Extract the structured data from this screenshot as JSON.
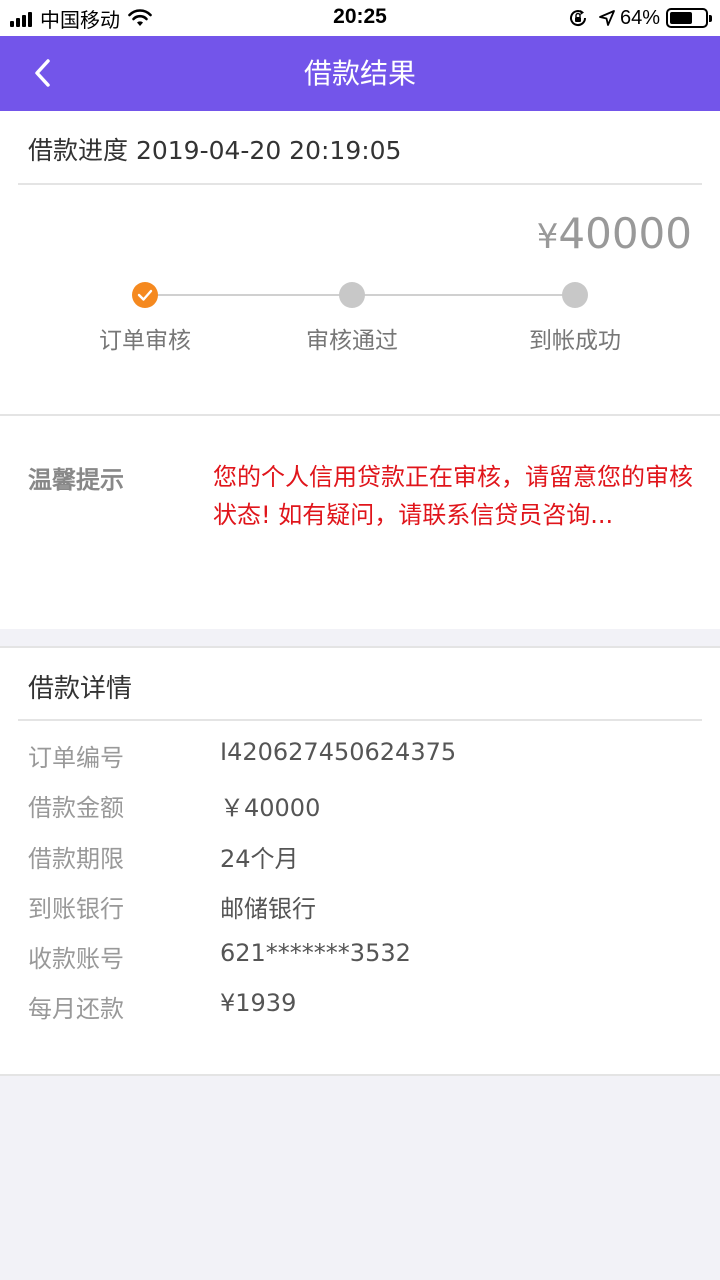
{
  "status_bar": {
    "carrier": "中国移动",
    "time": "20:25",
    "battery": "64%",
    "battery_level": 0.64
  },
  "nav": {
    "title": "借款结果"
  },
  "progress": {
    "header": "借款进度 2019-04-20 20:19:05",
    "amount_symbol": "¥",
    "amount": "40000",
    "steps": [
      {
        "label": "订单审核",
        "status": "done"
      },
      {
        "label": "审核通过",
        "status": "pending"
      },
      {
        "label": "到帐成功",
        "status": "pending"
      }
    ]
  },
  "tip": {
    "label": "温馨提示",
    "text": "您的个人信用贷款正在审核，请留意您的审核状态! 如有疑问，请联系信贷员咨询..."
  },
  "detail": {
    "title": "借款详情",
    "rows": [
      {
        "key": "订单编号",
        "value": "I420627450624375"
      },
      {
        "key": "借款金额",
        "value": "￥40000"
      },
      {
        "key": "借款期限",
        "value": "24个月"
      },
      {
        "key": "到账银行",
        "value": "邮储银行"
      },
      {
        "key": "收款账号",
        "value": "621*******3532"
      },
      {
        "key": "每月还款",
        "value": "¥1939"
      }
    ]
  },
  "colors": {
    "nav_bg": "#7355ea",
    "active_step": "#f5891f",
    "tip_text": "#e0151b"
  }
}
